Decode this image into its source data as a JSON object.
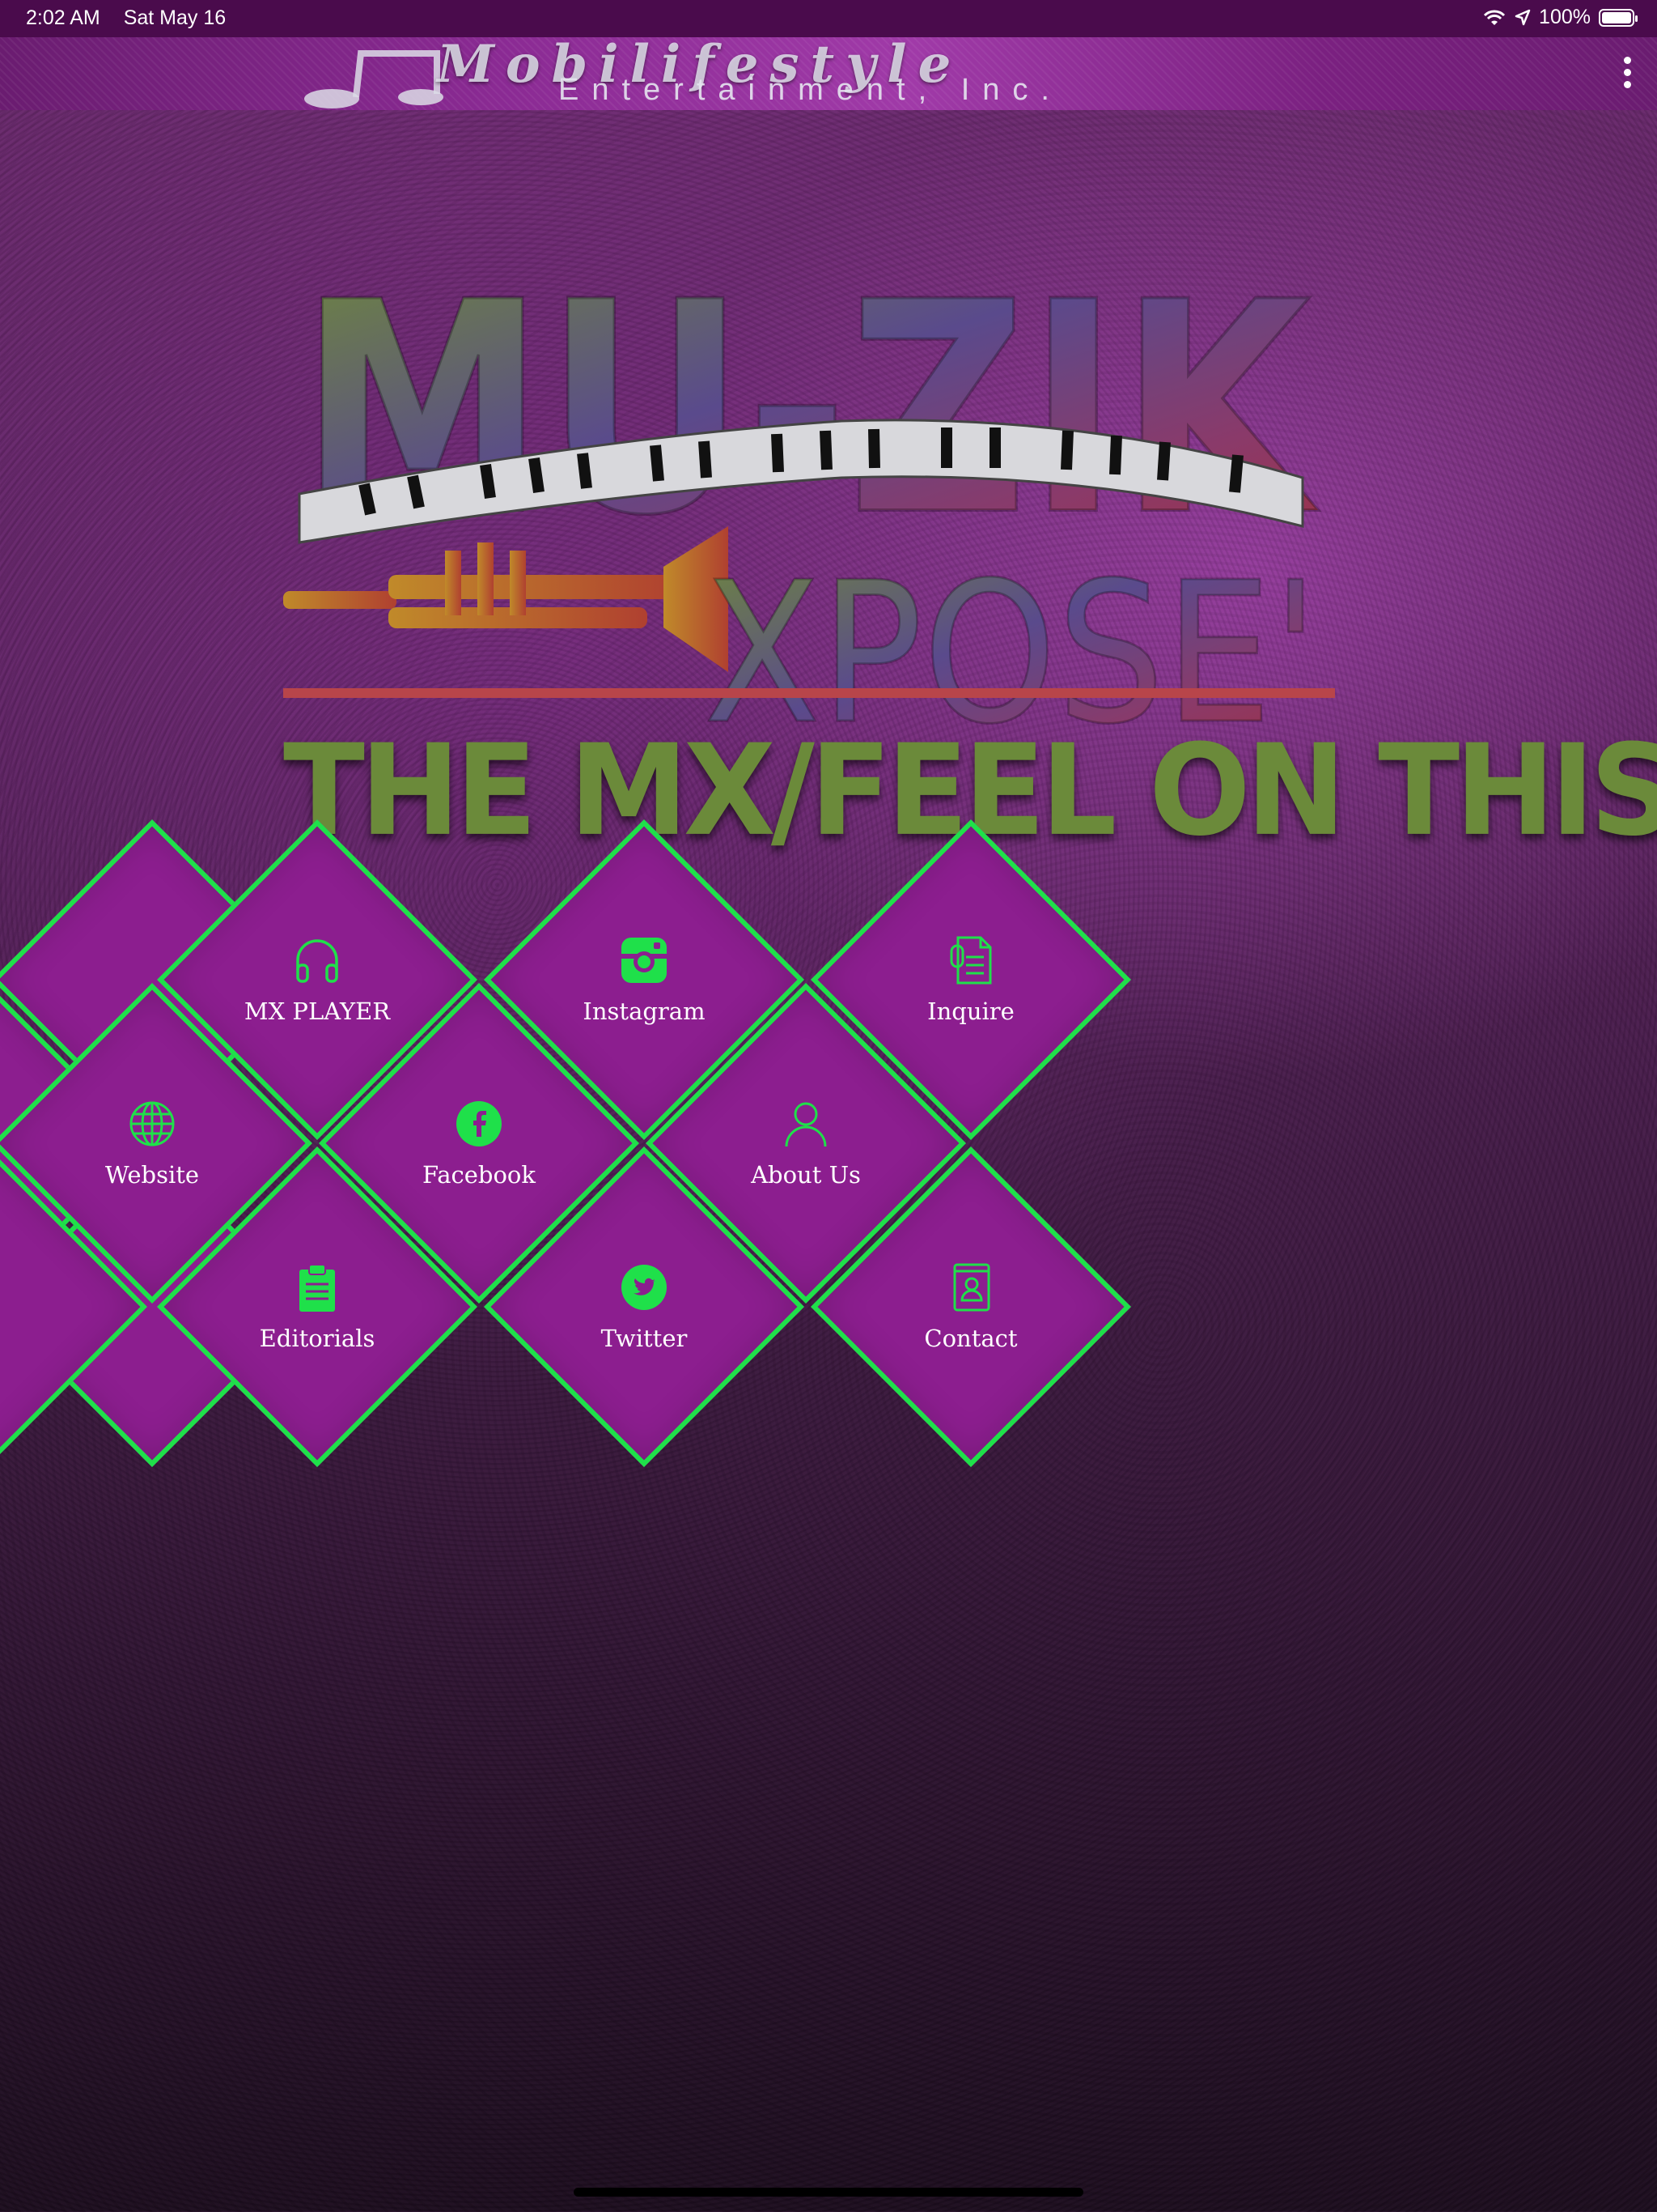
{
  "status_bar": {
    "time": "2:02 AM",
    "date": "Sat May 16",
    "battery": "100%"
  },
  "header": {
    "banner_title": "Mobilifestyle",
    "banner_subtitle": "Entertainment, Inc."
  },
  "hero": {
    "logo_line1": "MU-ZIK",
    "logo_line2": "XPOSE'",
    "tagline": "THE MX/FEEL ON THIS"
  },
  "menu": {
    "items": [
      {
        "label": "MX PLAYER",
        "icon": "headphones-icon"
      },
      {
        "label": "Instagram",
        "icon": "instagram-icon"
      },
      {
        "label": "Inquire",
        "icon": "document-icon"
      },
      {
        "label": "Website",
        "icon": "globe-icon"
      },
      {
        "label": "Facebook",
        "icon": "facebook-icon"
      },
      {
        "label": "About Us",
        "icon": "user-icon"
      },
      {
        "label": "Editorials",
        "icon": "clipboard-icon"
      },
      {
        "label": "Twitter",
        "icon": "twitter-icon"
      },
      {
        "label": "Contact",
        "icon": "contact-book-icon"
      }
    ]
  },
  "colors": {
    "accent_green": "#1fe04a",
    "tile_purple": "#8c1e8f",
    "status_bar": "#4a0b4c"
  }
}
